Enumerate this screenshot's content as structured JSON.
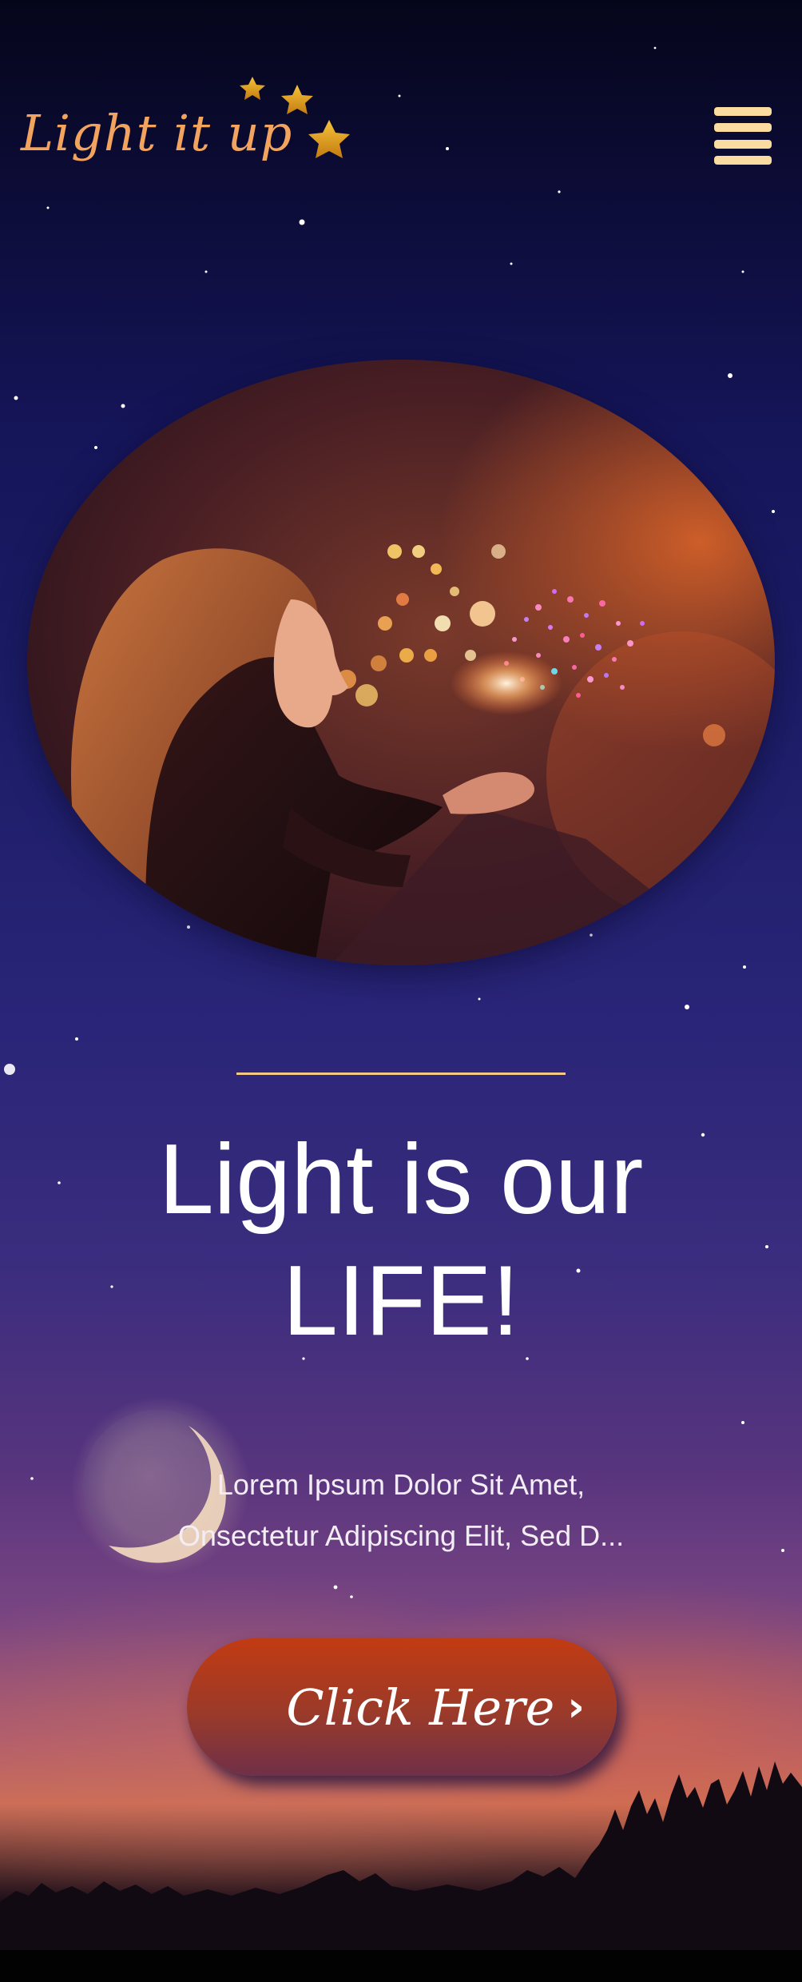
{
  "header": {
    "logo_text": "Light it up",
    "logo_decoration": "three-stars-icon",
    "menu_icon": "hamburger-menu-icon"
  },
  "hero": {
    "image_subject": "woman blowing sparkling lights"
  },
  "content": {
    "headline_line1": "Light is our",
    "headline_line2": "LIFE!",
    "subtext_line1": "Lorem Ipsum Dolor Sit Amet,",
    "subtext_line2": "Onsectetur Adipiscing Elit, Sed D..."
  },
  "cta": {
    "label": "Click Here",
    "icon": "chevron-right-icon"
  },
  "colors": {
    "accent": "#f6c985",
    "logo": "#f2a35e",
    "menu": "#fbdca0",
    "button_top": "#c23b12",
    "button_bottom": "#6f3048",
    "sky_top": "#05051a",
    "sky_mid": "#2a2578",
    "sky_horizon": "#cc6e57"
  }
}
